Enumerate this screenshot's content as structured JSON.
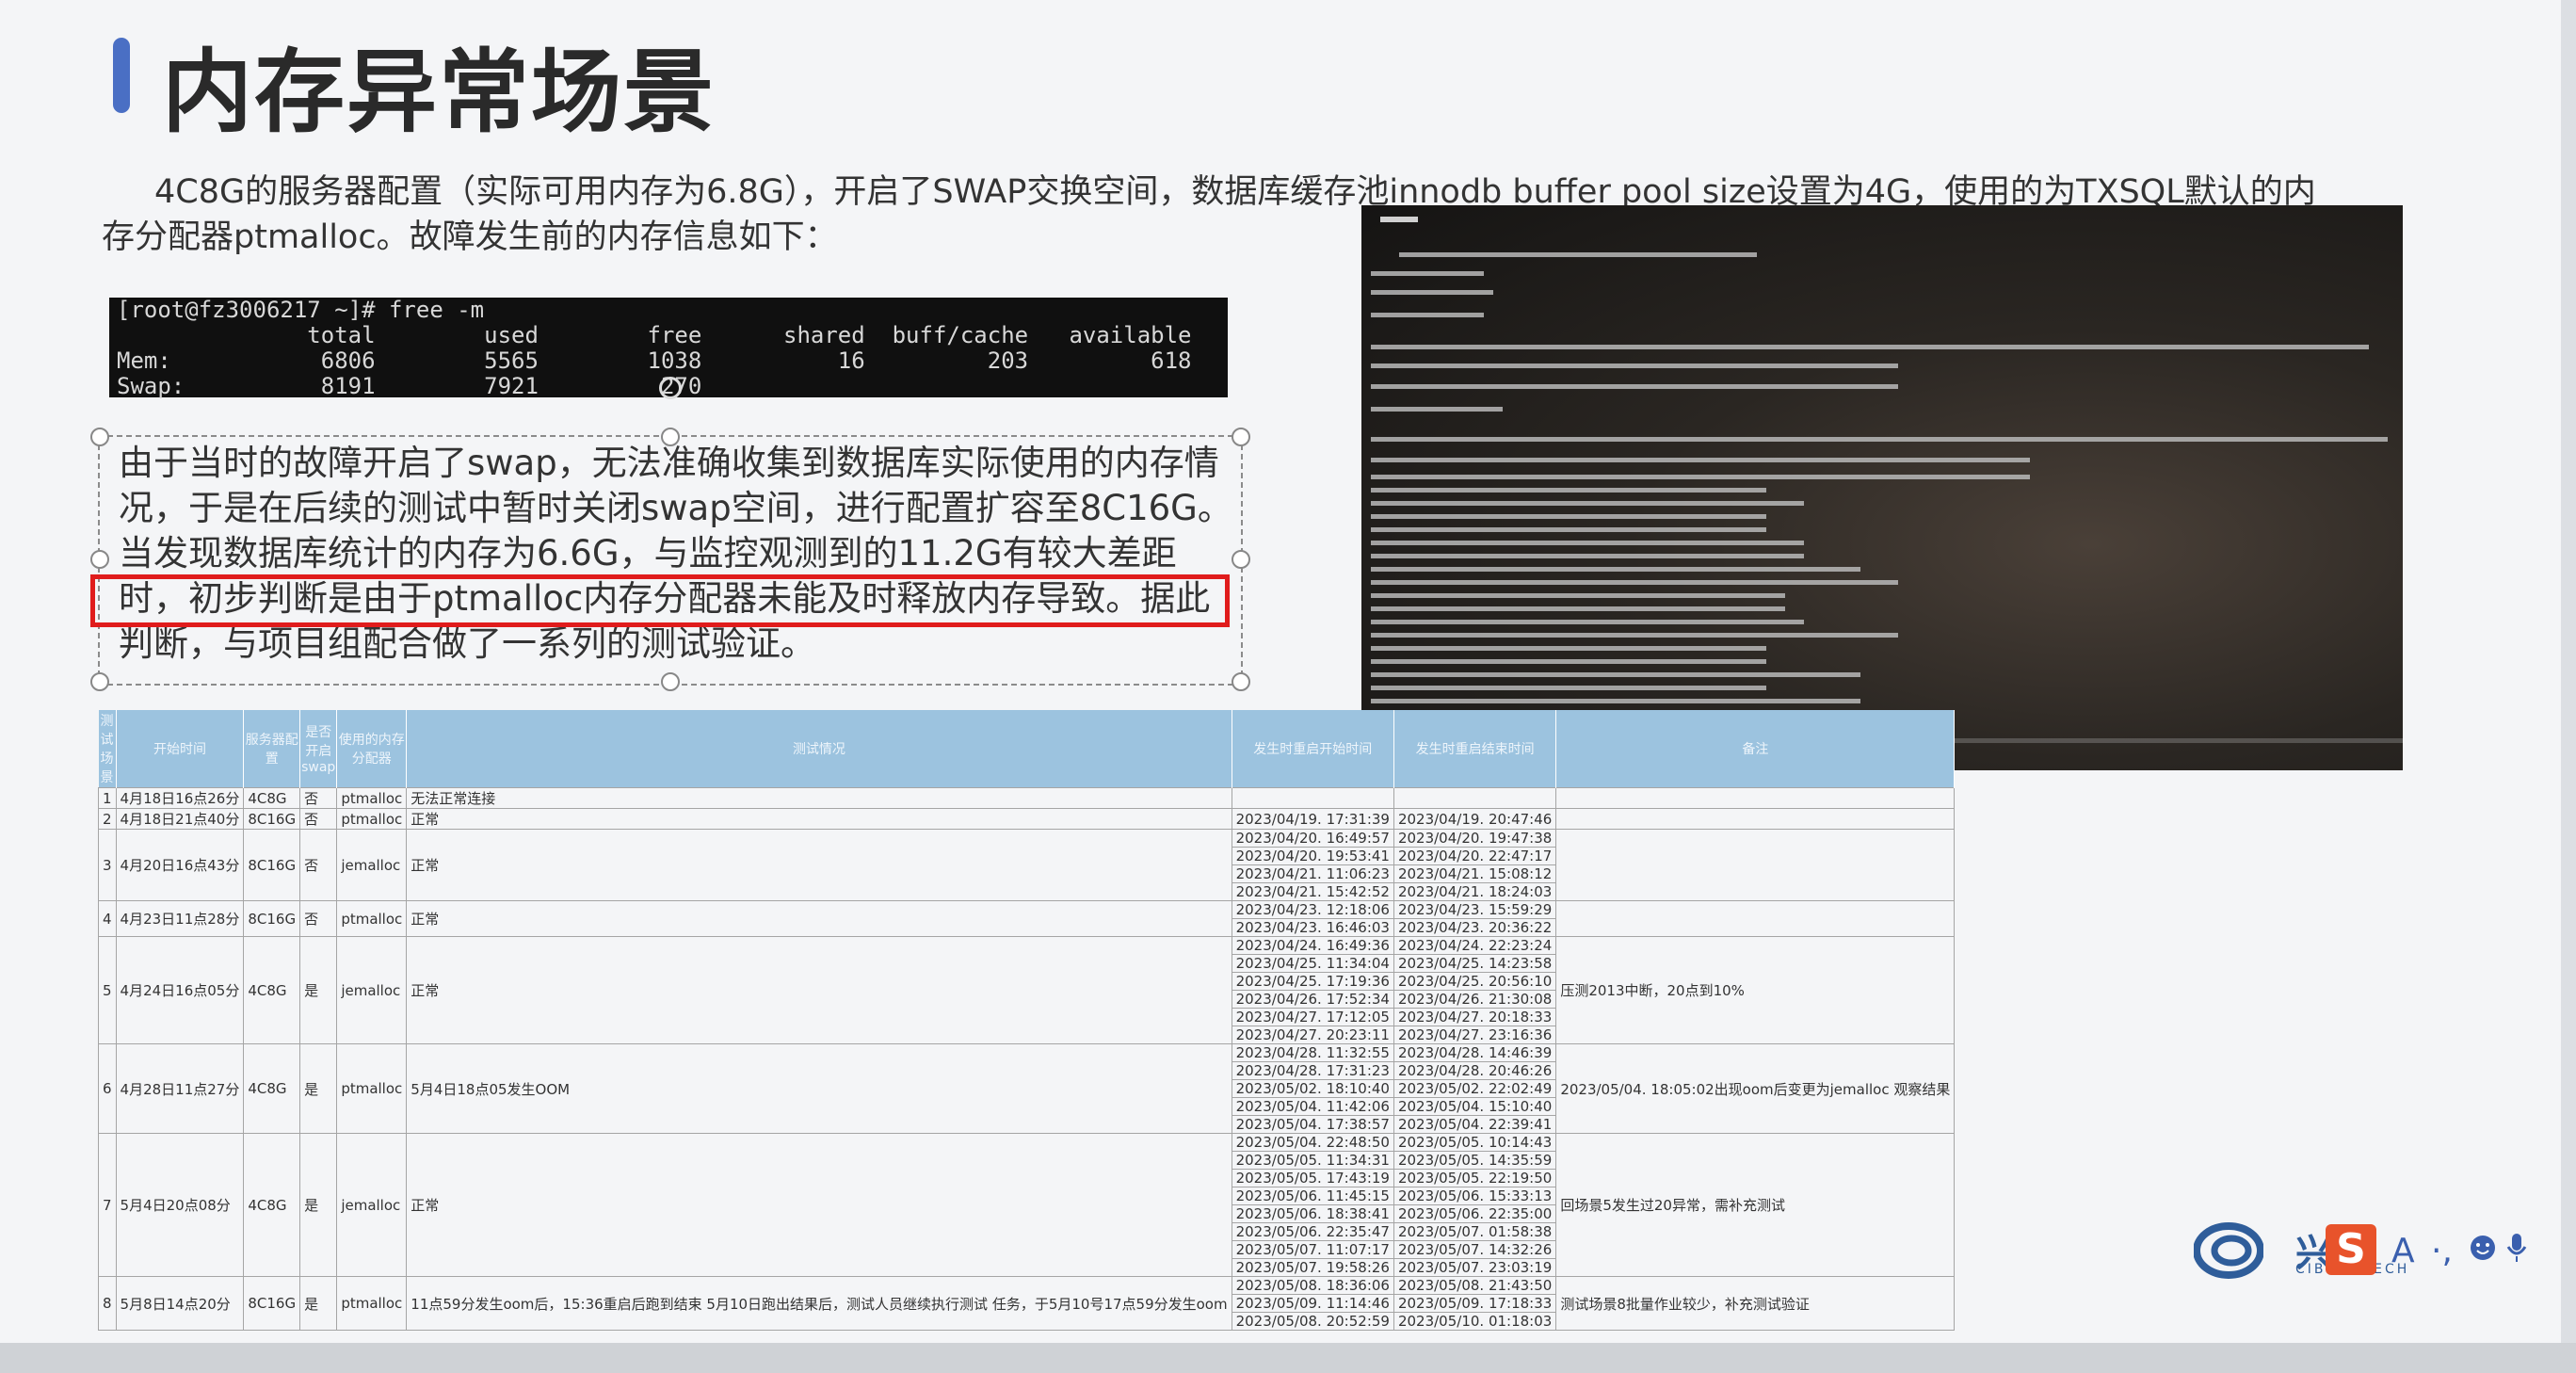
{
  "slide": {
    "title": "内存异常场景",
    "intro": "4C8G的服务器配置（实际可用内存为6.8G），开启了SWAP交换空间，数据库缓存池innodb buffer pool size设置为4G，使用的为TXSQL默认的内存分配器ptmalloc。故障发生前的内存信息如下："
  },
  "terminal": {
    "lines": [
      "[root@fz3006217 ~]# free -m",
      "              total        used        free      shared  buff/cache   available",
      "Mem:           6806        5565        1038          16         203         618",
      "Swap:          8191        7921         270"
    ]
  },
  "textbox": {
    "text": "由于当时的故障开启了swap，无法准确收集到数据库实际使用的内存情况，于是在后续的测试中暂时关闭swap空间，进行配置扩容至8C16G。当发现数据库统计的内存为6.6G，与监控观测到的11.2G有较大差距时，初步判断是由于ptmalloc内存分配器未能及时释放内存导致。据此判断，与项目组配合做了一系列的测试验证。"
  },
  "table": {
    "headers": [
      "测试场景",
      "开始时间",
      "服务器配置",
      "是否开启swap",
      "使用的内存分配器",
      "测试情况",
      "发生时重启开始时间",
      "发生时重启结束时间",
      "备注"
    ],
    "rows": [
      {
        "no": "1",
        "start": "4月18日16点26分",
        "cfg": "4C8G",
        "swap": "否",
        "alloc": "ptmalloc",
        "status": "无法正常连接",
        "times": [
          [
            "",
            ""
          ]
        ],
        "note": ""
      },
      {
        "no": "2",
        "start": "4月18日21点40分",
        "cfg": "8C16G",
        "swap": "否",
        "alloc": "ptmalloc",
        "status": "正常",
        "times": [
          [
            "2023/04/19. 17:31:39",
            "2023/04/19. 20:47:46"
          ]
        ],
        "note": ""
      },
      {
        "no": "3",
        "start": "4月20日16点43分",
        "cfg": "8C16G",
        "swap": "否",
        "alloc": "jemalloc",
        "status": "正常",
        "times": [
          [
            "2023/04/20. 16:49:57",
            "2023/04/20. 19:47:38"
          ],
          [
            "2023/04/20. 19:53:41",
            "2023/04/20. 22:47:17"
          ],
          [
            "2023/04/21. 11:06:23",
            "2023/04/21. 15:08:12"
          ],
          [
            "2023/04/21. 15:42:52",
            "2023/04/21. 18:24:03"
          ]
        ],
        "note": ""
      },
      {
        "no": "4",
        "start": "4月23日11点28分",
        "cfg": "8C16G",
        "swap": "否",
        "alloc": "ptmalloc",
        "status": "正常",
        "times": [
          [
            "2023/04/23. 12:18:06",
            "2023/04/23. 15:59:29"
          ],
          [
            "2023/04/23. 16:46:03",
            "2023/04/23. 20:36:22"
          ]
        ],
        "note": ""
      },
      {
        "no": "5",
        "start": "4月24日16点05分",
        "cfg": "4C8G",
        "swap": "是",
        "alloc": "jemalloc",
        "status": "正常",
        "times": [
          [
            "2023/04/24. 16:49:36",
            "2023/04/24. 22:23:24"
          ],
          [
            "2023/04/25. 11:34:04",
            "2023/04/25. 14:23:58"
          ],
          [
            "2023/04/25. 17:19:36",
            "2023/04/25. 20:56:10"
          ],
          [
            "2023/04/26. 17:52:34",
            "2023/04/26. 21:30:08"
          ],
          [
            "2023/04/27. 17:12:05",
            "2023/04/27. 20:18:33"
          ],
          [
            "2023/04/27. 20:23:11",
            "2023/04/27. 23:16:36"
          ]
        ],
        "note": "压测2013中断，20点到10%"
      },
      {
        "no": "6",
        "start": "4月28日11点27分",
        "cfg": "4C8G",
        "swap": "是",
        "alloc": "ptmalloc",
        "status": "5月4日18点05发生OOM",
        "times": [
          [
            "2023/04/28. 11:32:55",
            "2023/04/28. 14:46:39"
          ],
          [
            "2023/04/28. 17:31:23",
            "2023/04/28. 20:46:26"
          ],
          [
            "2023/05/02. 18:10:40",
            "2023/05/02. 22:02:49"
          ],
          [
            "2023/05/04. 11:42:06",
            "2023/05/04. 15:10:40"
          ],
          [
            "2023/05/04. 17:38:57",
            "2023/05/04. 22:39:41"
          ]
        ],
        "note": "2023/05/04. 18:05:02出现oom后变更为jemalloc 观察结果"
      },
      {
        "no": "7",
        "start": "5月4日20点08分",
        "cfg": "4C8G",
        "swap": "是",
        "alloc": "jemalloc",
        "status": "正常",
        "times": [
          [
            "2023/05/04. 22:48:50",
            "2023/05/05. 10:14:43"
          ],
          [
            "2023/05/05. 11:34:31",
            "2023/05/05. 14:35:59"
          ],
          [
            "2023/05/05. 17:43:19",
            "2023/05/05. 22:19:50"
          ],
          [
            "2023/05/06. 11:45:15",
            "2023/05/06. 15:33:13"
          ],
          [
            "2023/05/06. 18:38:41",
            "2023/05/06. 22:35:00"
          ],
          [
            "2023/05/06. 22:35:47",
            "2023/05/07. 01:58:38"
          ],
          [
            "2023/05/07. 11:07:17",
            "2023/05/07. 14:32:26"
          ],
          [
            "2023/05/07. 19:58:26",
            "2023/05/07. 23:03:19"
          ]
        ],
        "note": "回场景5发生过20异常，需补充测试"
      },
      {
        "no": "8",
        "start": "5月8日14点20分",
        "cfg": "8C16G",
        "swap": "是",
        "alloc": "ptmalloc",
        "status": "11点59分发生oom后，15:36重启后跑到结束 5月10日跑出结果后，测试人员继续执行测试 任务，于5月10号17点59分发生oom",
        "times": [
          [
            "2023/05/08. 18:36:06",
            "2023/05/08. 21:43:50"
          ],
          [
            "2023/05/09. 11:14:46",
            "2023/05/09. 17:18:33"
          ],
          [
            "2023/05/08. 20:52:59",
            "2023/05/10. 01:18:03"
          ]
        ],
        "note": "测试场景8批量作业较少，补充测试验证"
      }
    ]
  },
  "logo": {
    "cn": "兴业",
    "en": "CIB FINTECH"
  },
  "ime": {
    "s": "S",
    "a": "A",
    "dots": "·,",
    "icons": [
      "emoji-icon",
      "mic-icon"
    ]
  },
  "colors": {
    "accent": "#4a6fc4",
    "highlight": "#e01c1c",
    "header": "#9cc3df",
    "terminal": "#101010"
  }
}
